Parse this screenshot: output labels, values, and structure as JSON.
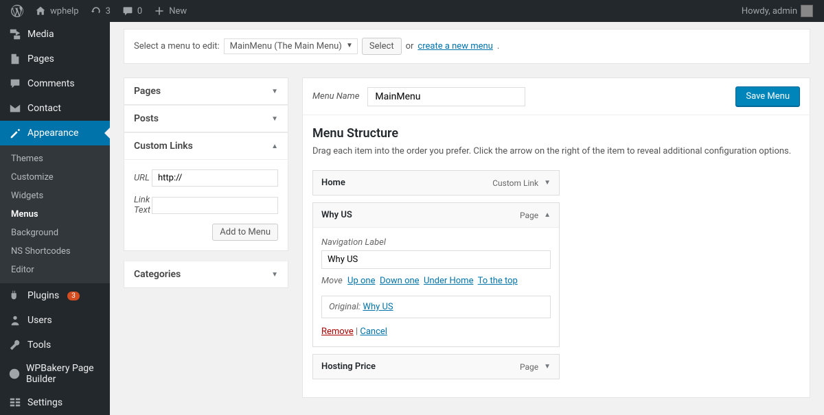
{
  "adminBar": {
    "siteName": "wphelp",
    "updatesCount": "3",
    "commentsCount": "0",
    "newLabel": "New",
    "howdy": "Howdy, admin"
  },
  "sidebar": {
    "media": "Media",
    "pages": "Pages",
    "comments": "Comments",
    "contact": "Contact",
    "appearance": "Appearance",
    "submenu": {
      "themes": "Themes",
      "customize": "Customize",
      "widgets": "Widgets",
      "menus": "Menus",
      "background": "Background",
      "nsShortcodes": "NS Shortcodes",
      "editor": "Editor"
    },
    "plugins": "Plugins",
    "pluginsBadge": "3",
    "users": "Users",
    "tools": "Tools",
    "wpbakery": "WPBakery Page Builder",
    "settings": "Settings"
  },
  "selectBar": {
    "label": "Select a menu to edit:",
    "selected": "MainMenu (The Main Menu)",
    "selectBtn": "Select",
    "or": "or",
    "createLink": "create a new menu",
    "period": "."
  },
  "leftCol": {
    "pages": "Pages",
    "posts": "Posts",
    "customLinks": "Custom Links",
    "urlLabel": "URL",
    "urlValue": "http://",
    "linkTextLabel": "Link Text",
    "linkTextValue": "",
    "addToMenu": "Add to Menu",
    "categories": "Categories"
  },
  "menuEdit": {
    "menuNameLabel": "Menu Name",
    "menuNameValue": "MainMenu",
    "saveBtn": "Save Menu",
    "structureTitle": "Menu Structure",
    "structureDesc": "Drag each item into the order you prefer. Click the arrow on the right of the item to reveal additional configuration options.",
    "items": [
      {
        "title": "Home",
        "type": "Custom Link",
        "expanded": false
      },
      {
        "title": "Why US",
        "type": "Page",
        "expanded": true,
        "navLabel": "Navigation Label",
        "navValue": "Why US",
        "moveLabel": "Move",
        "moveUp": "Up one",
        "moveDown": "Down one",
        "moveUnder": "Under Home",
        "moveTop": "To the top",
        "originalLabel": "Original:",
        "originalLink": "Why US",
        "remove": "Remove",
        "cancel": "Cancel"
      },
      {
        "title": "Hosting Price",
        "type": "Page",
        "expanded": false
      }
    ]
  }
}
